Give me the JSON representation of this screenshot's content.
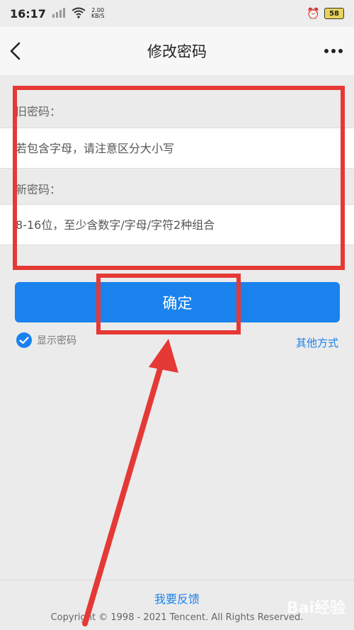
{
  "status_bar": {
    "time": "16:17",
    "net_speed_value": "2.00",
    "net_speed_unit": "KB/S",
    "battery": "58"
  },
  "nav": {
    "title": "修改密码"
  },
  "form": {
    "old_password_label": "旧密码：",
    "old_password_placeholder": "若包含字母，请注意区分大小写",
    "new_password_label": "新密码：",
    "new_password_placeholder": "8-16位，至少含数字/字母/字符2种组合",
    "confirm_label": "确定",
    "show_password_label": "显示密码",
    "show_password_checked": true,
    "other_method_label": "其他方式"
  },
  "footer": {
    "feedback_label": "我要反馈",
    "copyright": "Copyright © 1998 - 2021 Tencent. All Rights Reserved."
  },
  "watermark": "Bai经验",
  "colors": {
    "accent": "#1a82ed",
    "annotation": "#e53935"
  }
}
